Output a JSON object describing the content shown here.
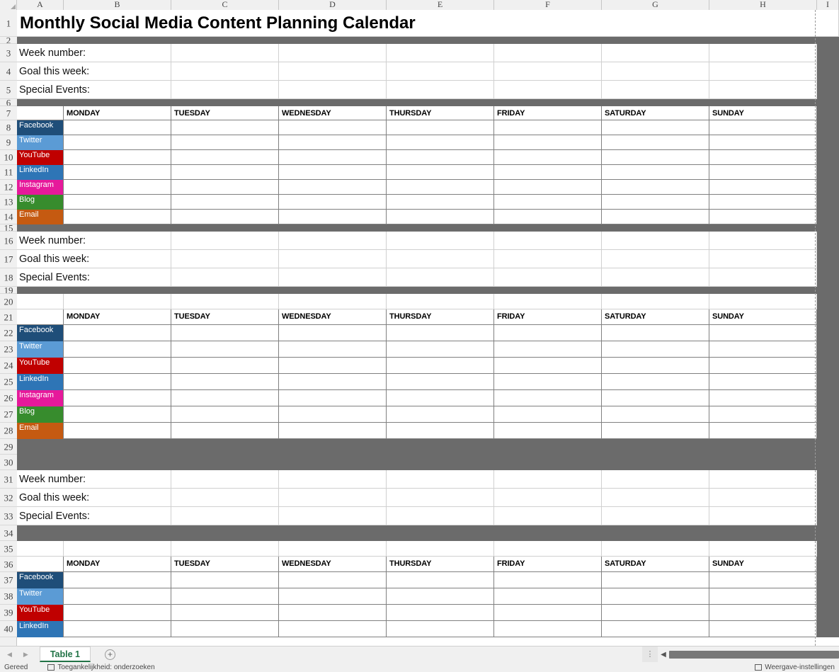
{
  "columns": [
    "A",
    "B",
    "C",
    "D",
    "E",
    "F",
    "G",
    "H",
    "I"
  ],
  "title": "Monthly Social Media Content Planning Calendar",
  "labels": {
    "week_number": "Week number:",
    "goal": "Goal this week:",
    "special_events": "Special Events:"
  },
  "days": [
    "MONDAY",
    "TUESDAY",
    "WEDNESDAY",
    "THURSDAY",
    "FRIDAY",
    "SATURDAY",
    "SUNDAY"
  ],
  "platforms": [
    {
      "name": "Facebook",
      "color": "#1F4E79"
    },
    {
      "name": "Twitter",
      "color": "#5B9BD5"
    },
    {
      "name": "YouTube",
      "color": "#C00000"
    },
    {
      "name": "LinkedIn",
      "color": "#2E75B6"
    },
    {
      "name": "Instagram",
      "color": "#E6199B"
    },
    {
      "name": "Blog",
      "color": "#378C2D"
    },
    {
      "name": "Email",
      "color": "#C55A11"
    }
  ],
  "row_numbers": [
    "1",
    "2",
    "3",
    "4",
    "5",
    "6",
    "7",
    "8",
    "9",
    "10",
    "11",
    "12",
    "13",
    "14",
    "15",
    "16",
    "17",
    "18",
    "19",
    "20",
    "21",
    "22",
    "23",
    "24",
    "25",
    "26",
    "27",
    "28",
    "29",
    "30",
    "31",
    "32",
    "33",
    "34",
    "35",
    "36",
    "37",
    "38",
    "39",
    "40"
  ],
  "tabbar": {
    "prev_arrow": "◀",
    "next_arrow": "▶",
    "sheet_name": "Table 1",
    "add_sheet": "+",
    "dots": "⋮",
    "scroll_left_arrow": "◀"
  },
  "statusbar": {
    "ready": "Gereed",
    "accessibility": "Toegankelijkheid: onderzoeken",
    "view_settings": "Weergave-instellingen"
  },
  "colors": {
    "separator_gray": "#6b6b6b",
    "accent_green": "#217346",
    "gridline": "#d0d0d0",
    "table_border": "#808080"
  }
}
